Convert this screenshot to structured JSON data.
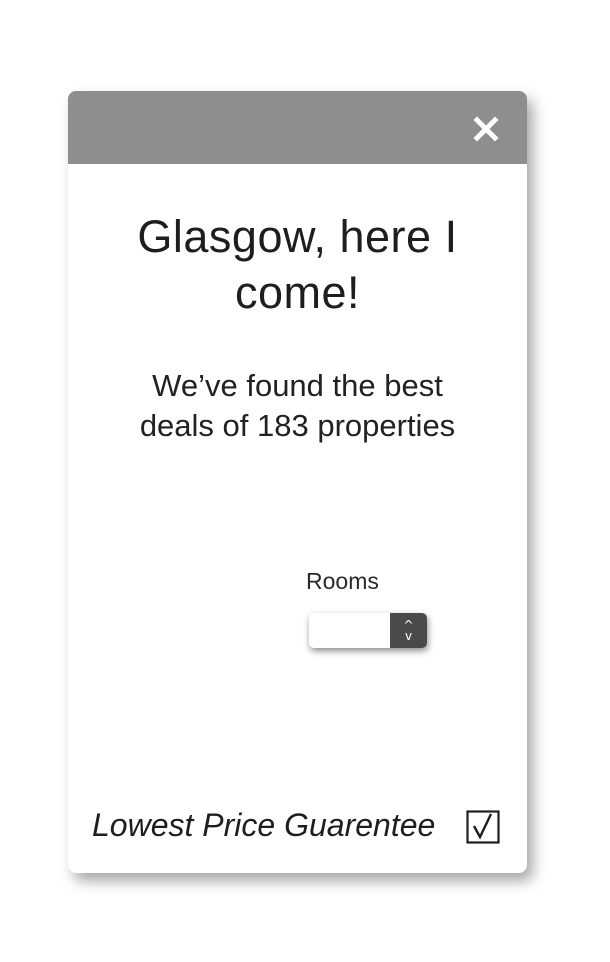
{
  "modal": {
    "close_icon": "close-icon",
    "title_line1": "Glasgow, here I",
    "title_line2": "come!",
    "subtitle_line1": "We’ve found the best",
    "subtitle_line2": "deals of 183 properties",
    "rooms_label": "Rooms",
    "rooms_value": "",
    "stepper_up": "^",
    "stepper_down": "v",
    "guarantee_text": "Lowest Price Guarentee",
    "guarantee_icon": "checkbox-checked-icon",
    "colors": {
      "header": "#8e8e8e",
      "stepper": "#4a4a4a",
      "text": "#1e1e1e"
    }
  }
}
